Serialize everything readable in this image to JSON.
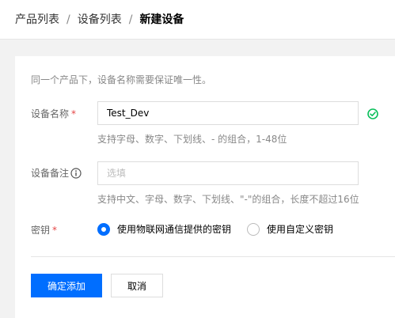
{
  "breadcrumb": {
    "items": [
      "产品列表",
      "设备列表"
    ],
    "current": "新建设备",
    "separator": "/"
  },
  "form": {
    "hint": "同一个产品下，设备名称需要保证唯一性。",
    "device_name": {
      "label": "设备名称",
      "required_mark": "*",
      "value": "Test_Dev",
      "help": "支持字母、数字、下划线、- 的组合，1-48位",
      "status_icon": "check-circle-icon"
    },
    "device_remark": {
      "label": "设备备注",
      "info_icon": "info-circle-icon",
      "placeholder": "选填",
      "value": "",
      "help": "支持中文、字母、数字、下划线、\"-\"的组合，长度不超过16位"
    },
    "secret": {
      "label": "密钥",
      "required_mark": "*",
      "options": [
        {
          "label": "使用物联网通信提供的密钥",
          "checked": true
        },
        {
          "label": "使用自定义密钥",
          "checked": false
        }
      ]
    }
  },
  "actions": {
    "confirm_label": "确定添加",
    "cancel_label": "取消"
  },
  "colors": {
    "primary": "#006eff",
    "success": "#0abf5b",
    "required": "#e54545"
  }
}
